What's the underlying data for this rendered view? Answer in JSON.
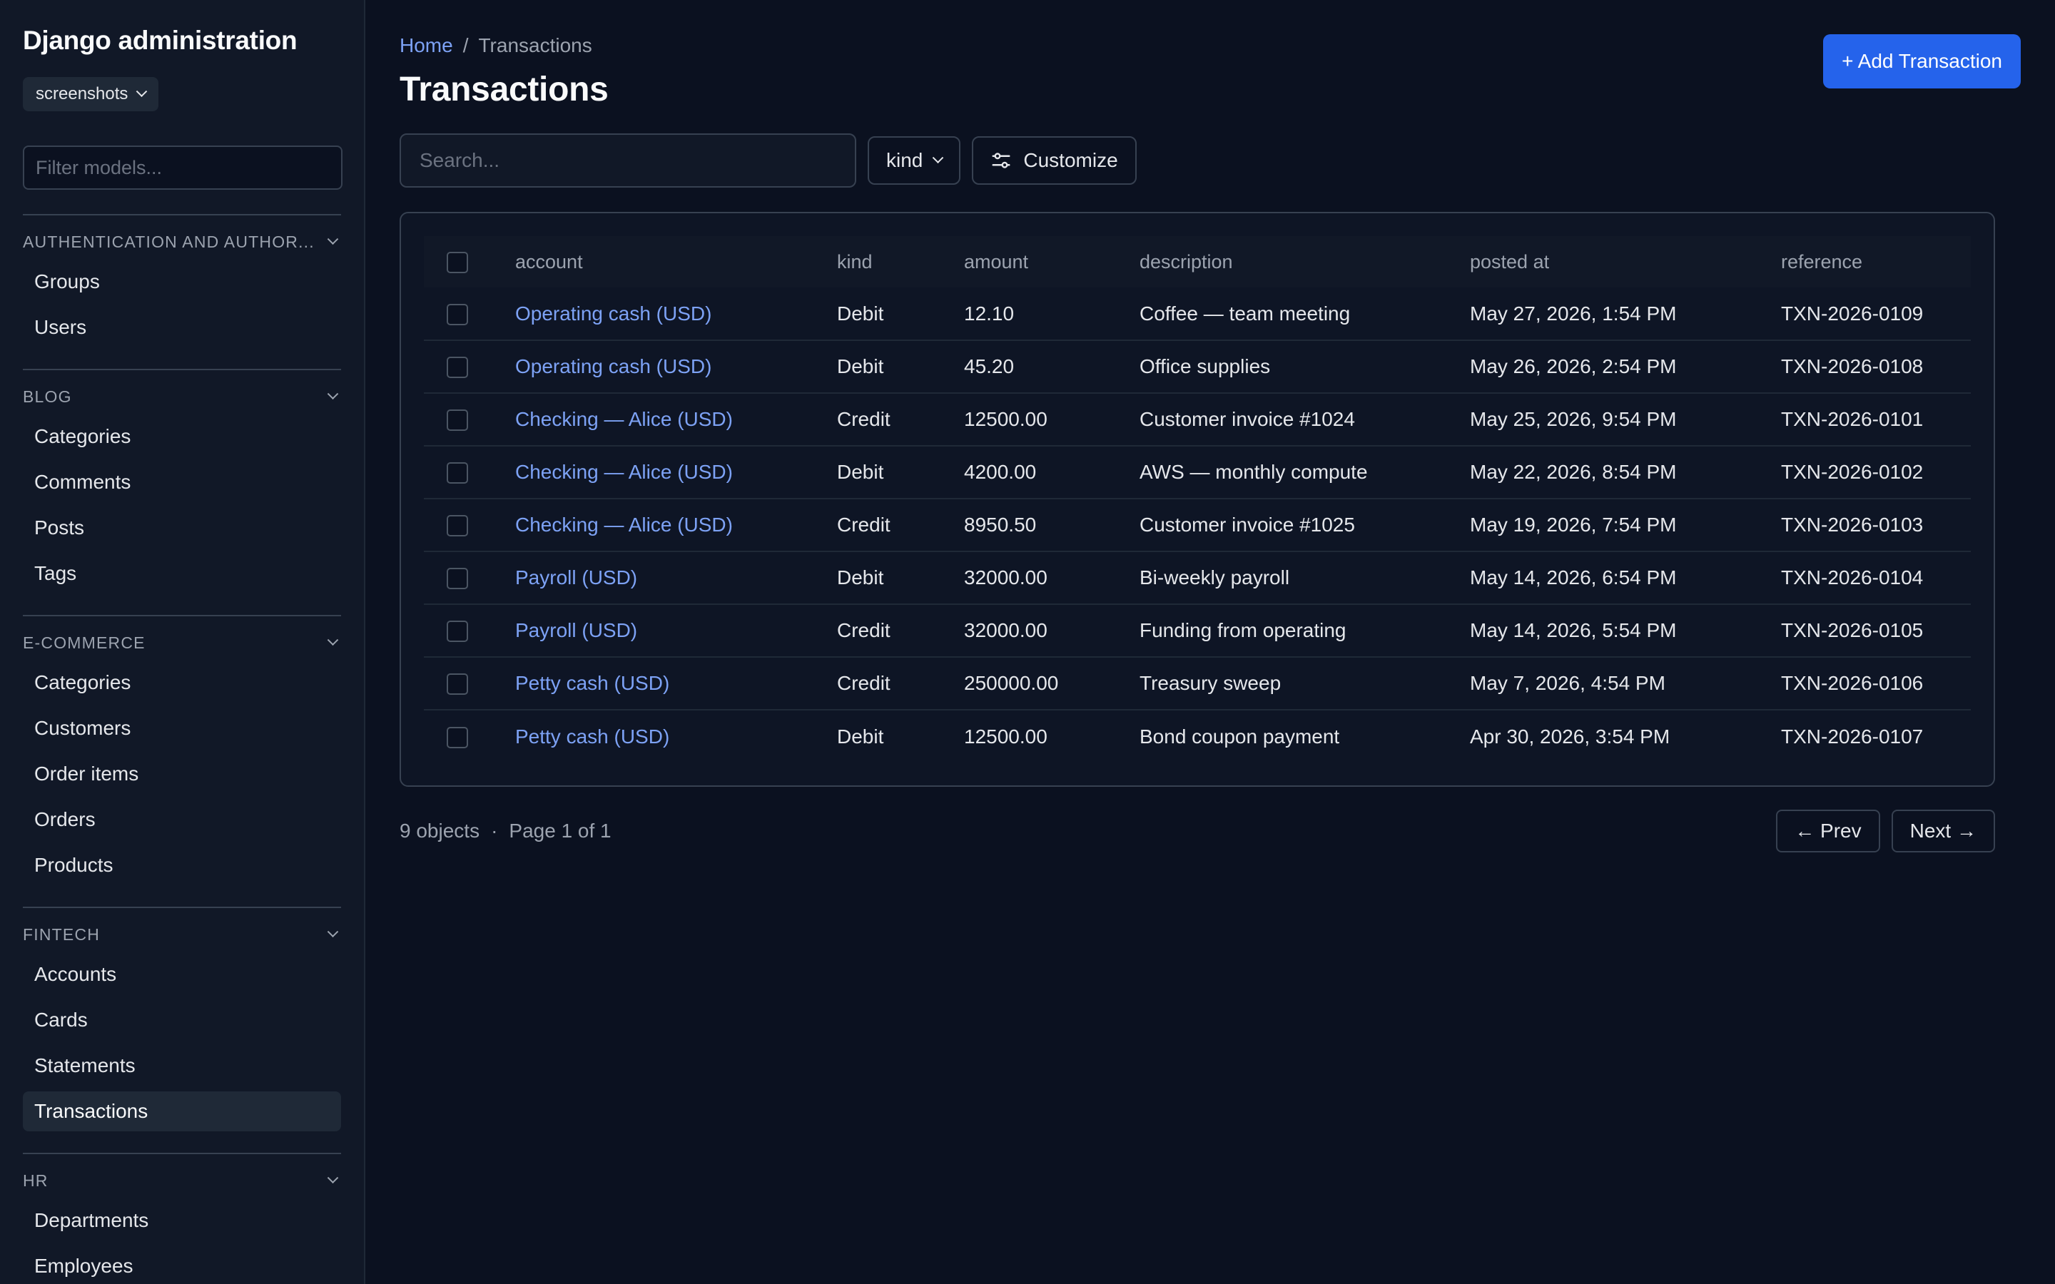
{
  "sidebar": {
    "brand": "Django administration",
    "db_select": "screenshots",
    "filter_placeholder": "Filter models...",
    "groups": [
      {
        "title": "AUTHENTICATION AND AUTHOR...",
        "items": [
          "Groups",
          "Users"
        ]
      },
      {
        "title": "BLOG",
        "items": [
          "Categories",
          "Comments",
          "Posts",
          "Tags"
        ]
      },
      {
        "title": "E-COMMERCE",
        "items": [
          "Categories",
          "Customers",
          "Order items",
          "Orders",
          "Products"
        ]
      },
      {
        "title": "FINTECH",
        "items": [
          "Accounts",
          "Cards",
          "Statements",
          "Transactions"
        ]
      },
      {
        "title": "HR",
        "items": [
          "Departments",
          "Employees"
        ]
      }
    ],
    "active_item": "Transactions"
  },
  "breadcrumb": {
    "home": "Home",
    "sep": "/",
    "current": "Transactions"
  },
  "page_title": "Transactions",
  "add_button": "+ Add Transaction",
  "toolbar": {
    "search_placeholder": "Search...",
    "kind_filter": "kind",
    "customize": "Customize"
  },
  "table": {
    "columns": [
      "account",
      "kind",
      "amount",
      "description",
      "posted at",
      "reference"
    ],
    "rows": [
      {
        "account": "Operating cash (USD)",
        "kind": "Debit",
        "amount": "12.10",
        "description": "Coffee — team meeting",
        "posted_at": "May 27, 2026, 1:54 PM",
        "reference": "TXN-2026-0109"
      },
      {
        "account": "Operating cash (USD)",
        "kind": "Debit",
        "amount": "45.20",
        "description": "Office supplies",
        "posted_at": "May 26, 2026, 2:54 PM",
        "reference": "TXN-2026-0108"
      },
      {
        "account": "Checking — Alice (USD)",
        "kind": "Credit",
        "amount": "12500.00",
        "description": "Customer invoice #1024",
        "posted_at": "May 25, 2026, 9:54 PM",
        "reference": "TXN-2026-0101"
      },
      {
        "account": "Checking — Alice (USD)",
        "kind": "Debit",
        "amount": "4200.00",
        "description": "AWS — monthly compute",
        "posted_at": "May 22, 2026, 8:54 PM",
        "reference": "TXN-2026-0102"
      },
      {
        "account": "Checking — Alice (USD)",
        "kind": "Credit",
        "amount": "8950.50",
        "description": "Customer invoice #1025",
        "posted_at": "May 19, 2026, 7:54 PM",
        "reference": "TXN-2026-0103"
      },
      {
        "account": "Payroll (USD)",
        "kind": "Debit",
        "amount": "32000.00",
        "description": "Bi-weekly payroll",
        "posted_at": "May 14, 2026, 6:54 PM",
        "reference": "TXN-2026-0104"
      },
      {
        "account": "Payroll (USD)",
        "kind": "Credit",
        "amount": "32000.00",
        "description": "Funding from operating",
        "posted_at": "May 14, 2026, 5:54 PM",
        "reference": "TXN-2026-0105"
      },
      {
        "account": "Petty cash (USD)",
        "kind": "Credit",
        "amount": "250000.00",
        "description": "Treasury sweep",
        "posted_at": "May 7, 2026, 4:54 PM",
        "reference": "TXN-2026-0106"
      },
      {
        "account": "Petty cash (USD)",
        "kind": "Debit",
        "amount": "12500.00",
        "description": "Bond coupon payment",
        "posted_at": "Apr 30, 2026, 3:54 PM",
        "reference": "TXN-2026-0107"
      }
    ]
  },
  "footer": {
    "count": "9 objects",
    "dot": "·",
    "page": "Page 1 of 1",
    "prev": "← Prev",
    "next": "Next →"
  },
  "colors": {
    "accent": "#2563eb",
    "link": "#7da2f5",
    "background": "#0b1120",
    "sidebar": "#111827"
  }
}
